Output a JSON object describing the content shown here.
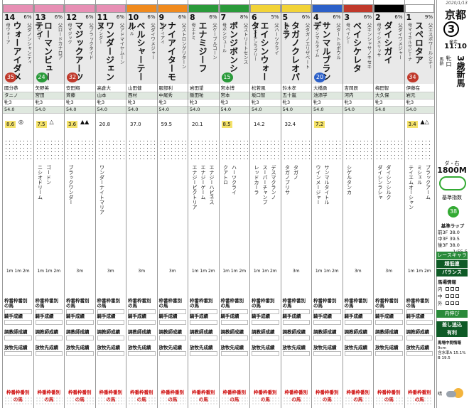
{
  "race": {
    "date": "2020/1/13",
    "venue": "京都",
    "race_no": "3",
    "post_label": "発走",
    "post_time": "11:10",
    "title": "3歳新馬",
    "sub1": "牝口",
    "sub2": "馬齢",
    "course": "ダ・右",
    "distance": "1800M",
    "baseline_label": "基準指数",
    "baseline": "38",
    "lap_label": "基準ラップ",
    "lap_first": "前3F 38.0",
    "lap_mid": "中3F 39.5",
    "lap_last": "後3F 38.0",
    "lap_total": "1:55.5",
    "race_char_label": "レースキャラ",
    "race_char": "超低速",
    "balance": "バランス",
    "baba_label": "馬場情報",
    "baba_rows": [
      "内",
      "中",
      "外"
    ],
    "pace_labels": [
      "内伸び",
      "差し追込",
      "有利"
    ],
    "notes_label": "馬場中間情報",
    "notes": [
      "9cm",
      "含水率A 15.1%",
      "B 19.5"
    ],
    "weather": "晴"
  },
  "horses": [
    {
      "no": "1",
      "gate_color": "#ffffff",
      "odds": "9%",
      "name": "スペロタア",
      "sire": "父エスポワールシチー",
      "dam": "母マイネルサビーナ",
      "weight": "34",
      "wcolor": "#c0392b",
      "jockey": "伊藤在",
      "trainer": "岩元",
      "age": "牝3",
      "kg": "54.0",
      "idx": "3.4",
      "sym": "▲△",
      "pedi1": "テイエムオーシャン",
      "pedi2": "ミシェル",
      "pedi3": "ブラックアーム",
      "finish": "1m 1m 2m"
    },
    {
      "no": "2",
      "gate_color": "#000000",
      "odds": "6%",
      "name": "ダイシガイ",
      "sire": "父ダイワメジャー",
      "dam": "母ダイシメリッサ",
      "weight": "",
      "wcolor": "#888",
      "jockey": "梅田智",
      "trainer": "大久保",
      "age": "牝3",
      "kg": "54.0",
      "idx": "",
      "sym": "",
      "pedi1": "ダイシンラシャ",
      "pedi2": "ダイシンシルク",
      "pedi3": "",
      "finish": "3m"
    },
    {
      "no": "3",
      "gate_color": "#c0392b",
      "odds": "6%",
      "name": "ベイシケレタ",
      "sire": "父キンシャサノキセキ",
      "dam": "母ベイシー",
      "weight": "",
      "wcolor": "#888",
      "jockey": "吉岡辰",
      "trainer": "河内",
      "age": "牝3",
      "kg": "54.0",
      "idx": "",
      "sym": "",
      "pedi1": "シゲルタンカ",
      "pedi2": "",
      "pedi3": "",
      "finish": "3m"
    },
    {
      "no": "4",
      "gate_color": "#2c60c8",
      "odds": "6%",
      "name": "サンマルブランデ",
      "sire": "父タートルボウル",
      "dam": "母サンマルタイム",
      "weight": "20",
      "wcolor": "#2c60c8",
      "jockey": "大橋勇",
      "trainer": "池添学",
      "age": "牝3",
      "kg": "54.0",
      "idx": "7.2",
      "sym": "",
      "pedi1": "ウインメージャー",
      "pedi2": "サンマルタイトル",
      "pedi3": "",
      "finish": "1m 1m 2m"
    },
    {
      "no": "5",
      "gate_color": "#f2d337",
      "odds": "6%",
      "name": "タガノクレオパトラ",
      "sire": "父タガノエリザベート",
      "dam": "母タガノ",
      "weight": "",
      "wcolor": "#888",
      "jockey": "鈴木孝",
      "trainer": "五十嵐",
      "age": "牝3",
      "kg": "54.0",
      "idx": "32.4",
      "sym": "",
      "pedi1": "タガノブリサ",
      "pedi2": "タガノ",
      "pedi3": "",
      "finish": "3m"
    },
    {
      "no": "6",
      "gate_color": "#f2d337",
      "odds": "5%",
      "name": "エイシンウォーター",
      "sire": "父ハーツクライ",
      "dam": "母エイシンラブリー",
      "weight": "",
      "wcolor": "#888",
      "jockey": "松若風",
      "trainer": "坂口智",
      "age": "牝3",
      "kg": "54.0",
      "idx": "14.2",
      "sym": "",
      "pedi1": "レッドカーラ",
      "pedi2": "スーパーチャンプ",
      "pedi3": "デスマクランノ",
      "finish": "1m 1m 2m"
    },
    {
      "no": "7",
      "gate_color": "#2a9a3a",
      "odds": "8%",
      "name": "ボンジボンシ",
      "sire": "父ストリートセンス",
      "dam": "母ボンジュール",
      "weight": "15",
      "wcolor": "#2a9a3a",
      "jockey": "宮本博",
      "trainer": "宮本",
      "age": "牝3",
      "kg": "54.0",
      "idx": "8.5",
      "sym": "",
      "pedi1": "クアトロ",
      "pedi2": "ハーツクライ",
      "pedi3": "",
      "finish": "1m 1m 2m"
    },
    {
      "no": "8",
      "gate_color": "#2a9a3a",
      "odds": "6%",
      "name": "エナミジーフ",
      "sire": "父ケーブルコーン",
      "dam": "母エナミ",
      "weight": "",
      "wcolor": "#888",
      "jockey": "岩田望",
      "trainer": "飯田祐",
      "age": "牝3",
      "kg": "54.0",
      "idx": "20.1",
      "sym": "",
      "pedi1": "エナジーピクトリア",
      "pedi2": "エナジーゲーム",
      "pedi3": "エナジーハピネス",
      "finish": "1m 1m 2m"
    },
    {
      "no": "9",
      "gate_color": "#f08a1d",
      "odds": "6%",
      "name": "ナイアイターモン",
      "sire": "父ストロングリターン",
      "dam": "母ナイアイ",
      "weight": "",
      "wcolor": "#888",
      "jockey": "服部利",
      "trainer": "中尾秀",
      "age": "牝3",
      "kg": "54.0",
      "idx": "59.5",
      "sym": "",
      "pedi1": "",
      "pedi2": "",
      "pedi3": "",
      "finish": "3m"
    },
    {
      "no": "10",
      "gate_color": "#f08a1d",
      "odds": "6%",
      "name": "ベルシャーテール",
      "sire": "父ダイワメジャー",
      "dam": "母ベル",
      "weight": "",
      "wcolor": "#888",
      "jockey": "山田健",
      "trainer": "西村",
      "age": "牝3",
      "kg": "54.0",
      "idx": "37.0",
      "sym": "",
      "pedi1": "",
      "pedi2": "",
      "pedi3": "",
      "finish": "3m"
    },
    {
      "no": "11",
      "gate_color": "#e78fb4",
      "odds": "6%",
      "name": "ワンダージェンヌ",
      "sire": "父アドマイヤムーン",
      "dam": "母ワンダー",
      "weight": "",
      "wcolor": "#888",
      "jockey": "高倉大",
      "trainer": "山本",
      "age": "牝3",
      "kg": "54.0",
      "idx": "20.8",
      "sym": "",
      "pedi1": "ワンダーナイトマリア",
      "pedi2": "",
      "pedi3": "",
      "finish": "3m"
    },
    {
      "no": "12",
      "gate_color": "#e78fb4",
      "odds": "6%",
      "name": "マジックアーツ",
      "sire": "父ブラックタイド",
      "dam": "母マジック",
      "weight": "32",
      "wcolor": "#c0392b",
      "jockey": "安田翔",
      "trainer": "斉藤",
      "age": "牝3",
      "kg": "54.0",
      "idx": "3.6",
      "sym": "▲▲",
      "pedi1": "ブラックワンダー",
      "pedi2": "",
      "pedi3": "",
      "finish": "3m"
    },
    {
      "no": "13",
      "gate_color": "#e78fb4",
      "odds": "6%",
      "name": "ローマンビューティ",
      "sire": "父ロードカナロア",
      "dam": "母ローマ",
      "weight": "24",
      "wcolor": "#2a9a3a",
      "jockey": "矢野英",
      "trainer": "宮田",
      "age": "牝3",
      "kg": "54.0",
      "idx": "7.5",
      "sym": "△",
      "pedi1": "ニシオドリーム",
      "pedi2": "ゴードン",
      "pedi3": "",
      "finish": "1m 1m 2m"
    },
    {
      "no": "14",
      "gate_color": "#e78fb4",
      "odds": "6%",
      "name": "ウォーアイダメ",
      "sire": "父ダノンシャンティ",
      "dam": "母ウォーア",
      "weight": "35",
      "wcolor": "#c0392b",
      "jockey": "國分恭",
      "trainer": "タニノ",
      "age": "牝3",
      "kg": "54.0",
      "idx": "8.6",
      "sym": "◎",
      "pedi1": "",
      "pedi2": "",
      "pedi3": "",
      "finish": "1m 1m 2m"
    }
  ],
  "footer": {
    "label_a": "枠番枠番別の馬",
    "label_b": "騎手成績",
    "label_c": "調教師成績",
    "label_d": "放牧先成績",
    "label_e": "枠番枠番別の馬"
  }
}
